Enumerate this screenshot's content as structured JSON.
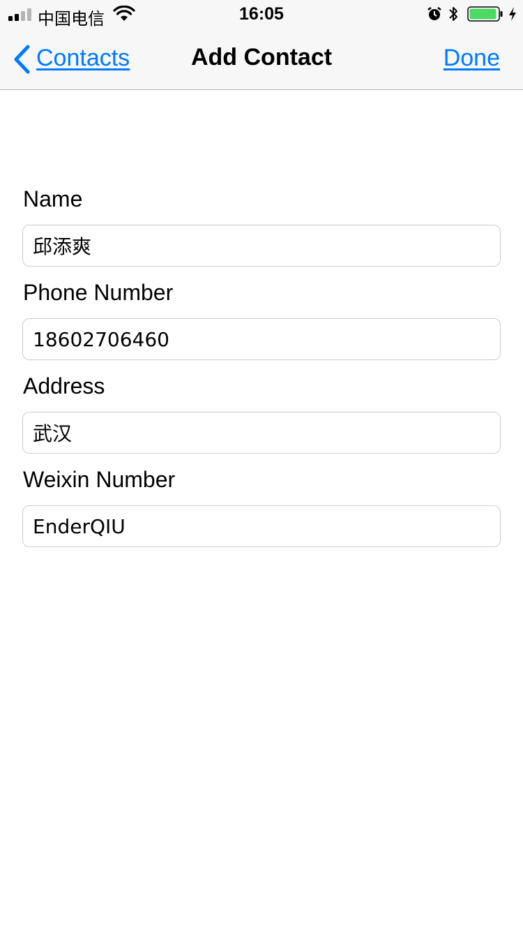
{
  "status_bar": {
    "carrier": "中国电信",
    "time": "16:05",
    "signal_bars_active": 2,
    "signal_bars_total": 4,
    "battery_level": 0.95,
    "battery_color": "#4cd964",
    "icons": [
      "signal-icon",
      "wifi-icon",
      "alarm-icon",
      "bluetooth-icon",
      "battery-icon",
      "charging-bolt-icon"
    ]
  },
  "nav": {
    "back_label": "Contacts",
    "title": "Add Contact",
    "done_label": "Done",
    "accent_color": "#007aff",
    "back_icon": "chevron-left-icon"
  },
  "form": {
    "name": {
      "label": "Name",
      "value": "邱添爽"
    },
    "phone": {
      "label": "Phone Number",
      "value": "18602706460"
    },
    "address": {
      "label": "Address",
      "value": "武汉"
    },
    "weixin": {
      "label": "Weixin Number",
      "value": "EnderQIU"
    }
  }
}
